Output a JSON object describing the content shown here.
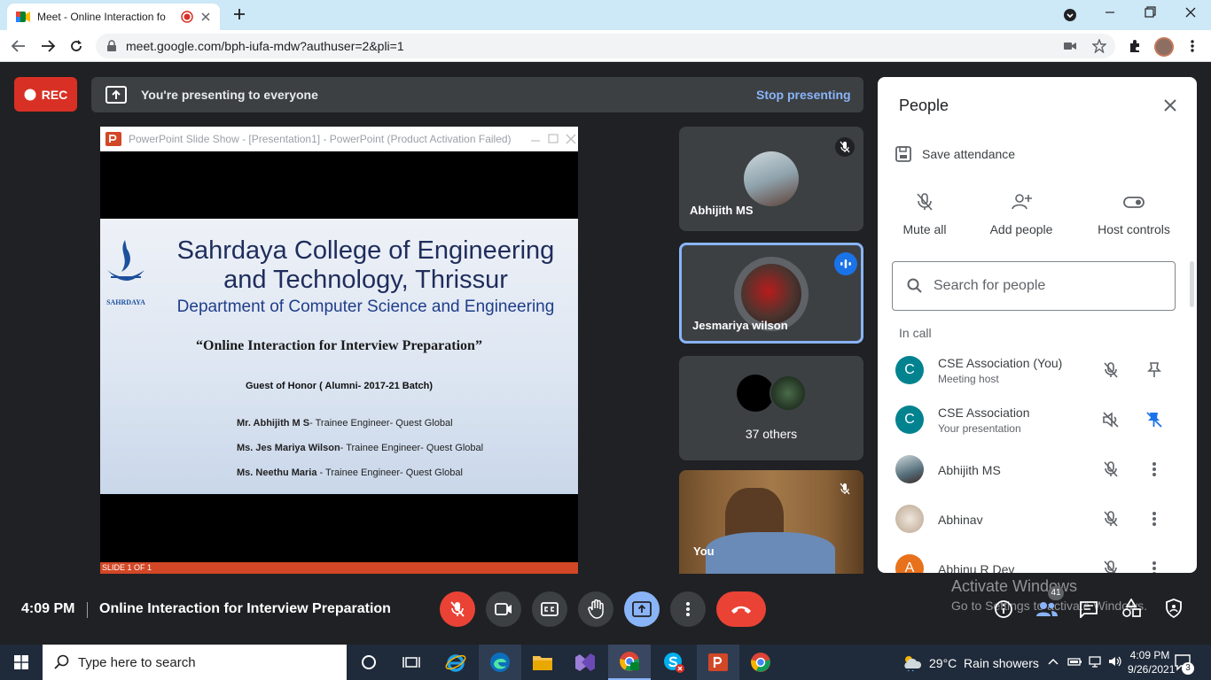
{
  "browser": {
    "tab_title": "Meet - Online Interaction fo",
    "url": "meet.google.com/bph-iufa-mdw?authuser=2&pli=1"
  },
  "meet": {
    "rec_label": "REC",
    "presenting_text": "You're presenting to everyone",
    "stop_presenting": "Stop presenting",
    "ppt_title": "PowerPoint Slide Show - [Presentation1] - PowerPoint (Product Activation Failed)",
    "slide": {
      "logo_text": "SAHRDAYA",
      "line1": "Sahrdaya College of Engineering",
      "line2": "and Technology, Thrissur",
      "line3": "Department of Computer Science and Engineering",
      "line4": "“Online Interaction for Interview Preparation”",
      "line5": "Guest of Honor ( Alumni- 2017-21 Batch)",
      "guests": [
        {
          "name": "Mr. Abhijith M S",
          "role": "- Trainee Engineer- Quest Global"
        },
        {
          "name": "Ms. Jes Mariya Wilson",
          "role": "- Trainee Engineer- Quest Global"
        },
        {
          "name": "Ms. Neethu Maria",
          "role": " - Trainee Engineer- Quest Global"
        }
      ],
      "footer": "SLIDE 1 OF 1"
    },
    "tiles": {
      "abhijith": "Abhijith MS",
      "jesmariya": "Jesmariya wilson",
      "others": "37 others",
      "you": "You"
    },
    "bottom": {
      "time": "4:09 PM",
      "meeting_title": "Online Interaction for Interview Preparation",
      "participants_count": "41",
      "watermark_line1": "Activate Windows",
      "watermark_line2": "Go to Settings to activate Windows."
    }
  },
  "people": {
    "title": "People",
    "save_attendance": "Save attendance",
    "mute_all": "Mute all",
    "add_people": "Add people",
    "host_controls": "Host controls",
    "search_placeholder": "Search for people",
    "in_call": "In call",
    "rows": [
      {
        "initial": "C",
        "name": "CSE Association (You)",
        "sub": "Meeting host"
      },
      {
        "initial": "C",
        "name": "CSE Association",
        "sub": "Your presentation"
      },
      {
        "initial": "",
        "name": "Abhijith MS",
        "sub": ""
      },
      {
        "initial": "",
        "name": "Abhinav",
        "sub": ""
      },
      {
        "initial": "A",
        "name": "Abhinu R Dev",
        "sub": ""
      }
    ]
  },
  "taskbar": {
    "search_placeholder": "Type here to search",
    "weather": "29°C  Rain showers",
    "time": "4:09 PM",
    "date": "9/26/2021",
    "notifications": "3"
  },
  "colors": {
    "accent": "#1a73e8",
    "danger": "#ea4335",
    "rec": "#d93025",
    "avatar": "#00838f",
    "avatar_a": "#e8711c"
  }
}
